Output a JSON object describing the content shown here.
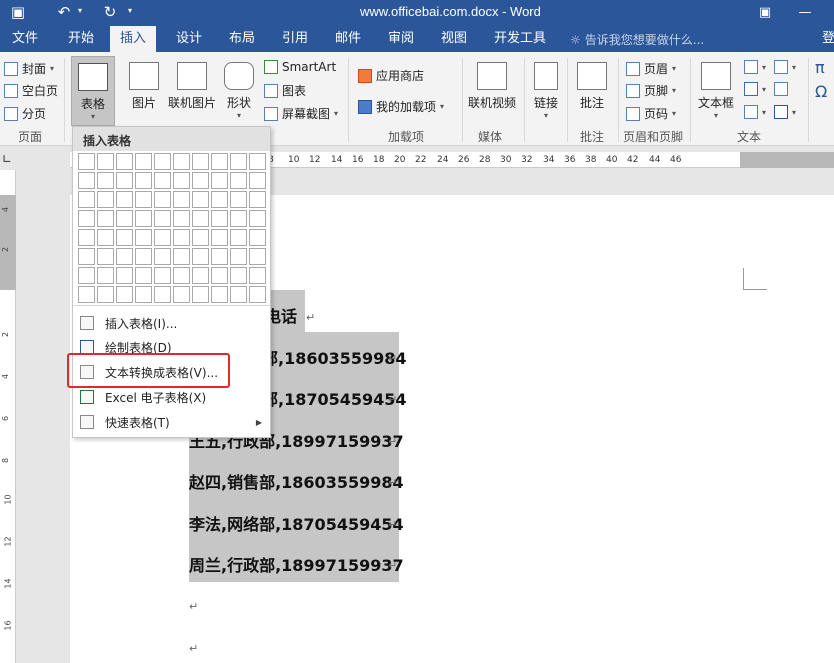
{
  "window": {
    "title": "www.officebai.com.docx - Word",
    "minimize_icon": "—",
    "maximize_icon": "▢"
  },
  "tabs": [
    {
      "label": "文件"
    },
    {
      "label": "开始"
    },
    {
      "label": "插入"
    },
    {
      "label": "设计"
    },
    {
      "label": "布局"
    },
    {
      "label": "引用"
    },
    {
      "label": "邮件"
    },
    {
      "label": "审阅"
    },
    {
      "label": "视图"
    },
    {
      "label": "开发工具"
    }
  ],
  "tell_me": "告诉我您想要做什么...",
  "sign_in": "登",
  "ribbon": {
    "pages": {
      "cover": "封面",
      "blank": "空白页",
      "break": "分页",
      "group": "页面"
    },
    "table": {
      "label": "表格"
    },
    "pictures": {
      "label": "图片"
    },
    "online_pictures": {
      "label": "联机图片"
    },
    "shapes": {
      "label": "形状"
    },
    "smartart": "SmartArt",
    "chart": "图表",
    "screenshot": "屏幕截图",
    "store": "应用商店",
    "my_addins": "我的加载项",
    "addins_group": "加载项",
    "online_video": {
      "label": "联机视频"
    },
    "media_group": "媒体",
    "link": {
      "label": "链接"
    },
    "comment": {
      "label": "批注"
    },
    "comment_group": "批注",
    "header": "页眉",
    "footer": "页脚",
    "page_number": "页码",
    "header_footer_group": "页眉和页脚",
    "textbox": {
      "label": "文本框"
    },
    "text_group": "文本",
    "omega": "Ω",
    "pi": "π"
  },
  "ruler": {
    "h_ticks": [
      "8",
      "10",
      "12",
      "14",
      "16",
      "18",
      "20",
      "22",
      "24",
      "26",
      "28",
      "30",
      "32",
      "34",
      "36",
      "38",
      "40",
      "42",
      "44",
      "46"
    ],
    "v_ticks": [
      "4",
      "2",
      "2",
      "4",
      "6",
      "8",
      "10",
      "12",
      "14",
      "16"
    ]
  },
  "document": {
    "lines": [
      "电话",
      "部,18603559984",
      "部,18705459454",
      "王五,行政部,18997159937",
      "赵四,销售部,18603559984",
      "李法,网络部,18705459454",
      "周兰,行政部,18997159937"
    ],
    "para_mark": "↵"
  },
  "dropdown": {
    "header": "插入表格",
    "items": [
      {
        "label": "插入表格(I)..."
      },
      {
        "label": "绘制表格(D)"
      },
      {
        "label": "文本转换成表格(V)..."
      },
      {
        "label": "Excel 电子表格(X)"
      },
      {
        "label": "快速表格(T)"
      }
    ]
  }
}
